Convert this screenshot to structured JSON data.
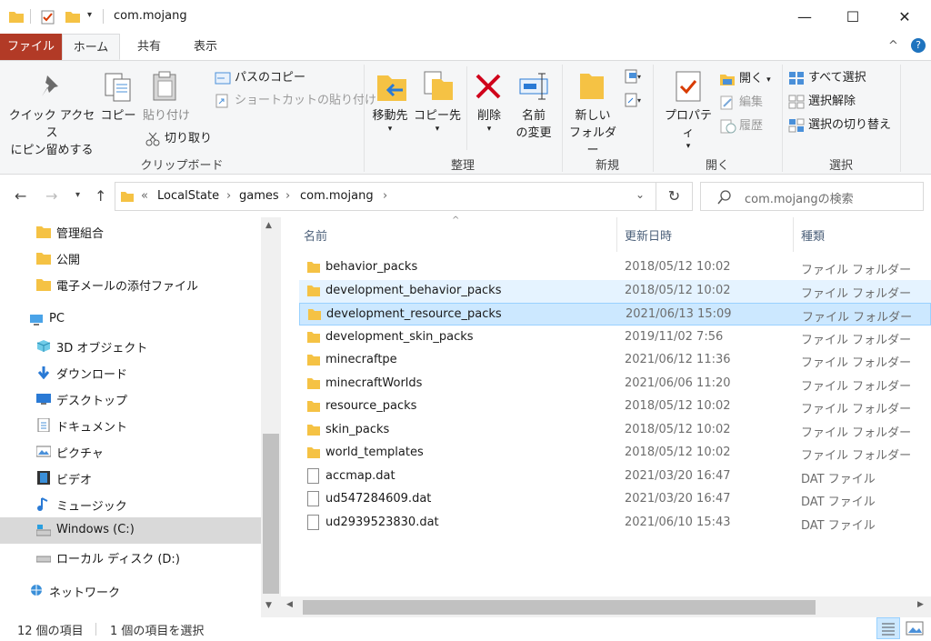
{
  "window": {
    "title": "com.mojang",
    "minimize": "—",
    "maximize": "☐",
    "close": "✕"
  },
  "ribbon_tabs": [
    "ファイル",
    "ホーム",
    "共有",
    "表示"
  ],
  "ribbon": {
    "clipboard": {
      "pin_line1": "クイック アクセス",
      "pin_line2": "にピン留めする",
      "copy": "コピー",
      "paste": "貼り付け",
      "copy_path": "パスのコピー",
      "paste_shortcut": "ショートカットの貼り付け",
      "cut": "切り取り",
      "group": "クリップボード"
    },
    "organize": {
      "move_to": "移動先",
      "copy_to": "コピー先",
      "delete": "削除",
      "rename_line1": "名前",
      "rename_line2": "の変更",
      "group": "整理"
    },
    "new": {
      "new_folder_line1": "新しい",
      "new_folder_line2": "フォルダー",
      "group": "新規"
    },
    "open": {
      "properties": "プロパティ",
      "open": "開く",
      "edit": "編集",
      "history": "履歴",
      "group": "開く"
    },
    "select": {
      "select_all": "すべて選択",
      "select_none": "選択解除",
      "invert": "選択の切り替え",
      "group": "選択"
    }
  },
  "address": {
    "overflow": "«",
    "crumbs": [
      "LocalState",
      "games",
      "com.mojang"
    ],
    "search_placeholder": "com.mojangの検索"
  },
  "nav": {
    "quick": [
      "管理組合",
      "公開",
      "電子メールの添付ファイル"
    ],
    "pc": "PC",
    "pc_items": [
      "3D オブジェクト",
      "ダウンロード",
      "デスクトップ",
      "ドキュメント",
      "ピクチャ",
      "ビデオ",
      "ミュージック",
      "Windows (C:)",
      "ローカル ディスク (D:)"
    ],
    "network": "ネットワーク"
  },
  "columns": {
    "name": "名前",
    "date": "更新日時",
    "type": "種類"
  },
  "files": [
    {
      "name": "behavior_packs",
      "date": "2018/05/12 10:02",
      "type": "ファイル フォルダー",
      "kind": "folder"
    },
    {
      "name": "development_behavior_packs",
      "date": "2018/05/12 10:02",
      "type": "ファイル フォルダー",
      "kind": "folder"
    },
    {
      "name": "development_resource_packs",
      "date": "2021/06/13 15:09",
      "type": "ファイル フォルダー",
      "kind": "folder"
    },
    {
      "name": "development_skin_packs",
      "date": "2019/11/02 7:56",
      "type": "ファイル フォルダー",
      "kind": "folder"
    },
    {
      "name": "minecraftpe",
      "date": "2021/06/12 11:36",
      "type": "ファイル フォルダー",
      "kind": "folder"
    },
    {
      "name": "minecraftWorlds",
      "date": "2021/06/06 11:20",
      "type": "ファイル フォルダー",
      "kind": "folder"
    },
    {
      "name": "resource_packs",
      "date": "2018/05/12 10:02",
      "type": "ファイル フォルダー",
      "kind": "folder"
    },
    {
      "name": "skin_packs",
      "date": "2018/05/12 10:02",
      "type": "ファイル フォルダー",
      "kind": "folder"
    },
    {
      "name": "world_templates",
      "date": "2018/05/12 10:02",
      "type": "ファイル フォルダー",
      "kind": "folder"
    },
    {
      "name": "accmap.dat",
      "date": "2021/03/20 16:47",
      "type": "DAT ファイル",
      "kind": "file"
    },
    {
      "name": "ud547284609.dat",
      "date": "2021/03/20 16:47",
      "type": "DAT ファイル",
      "kind": "file"
    },
    {
      "name": "ud2939523830.dat",
      "date": "2021/06/10 15:43",
      "type": "DAT ファイル",
      "kind": "file"
    }
  ],
  "status": {
    "count": "12 個の項目",
    "selected": "1 個の項目を選択"
  },
  "colors": {
    "folder": "#f5c244",
    "file_tab": "#b23a26",
    "selection": "#cce8ff",
    "hover": "#e5f3ff"
  }
}
